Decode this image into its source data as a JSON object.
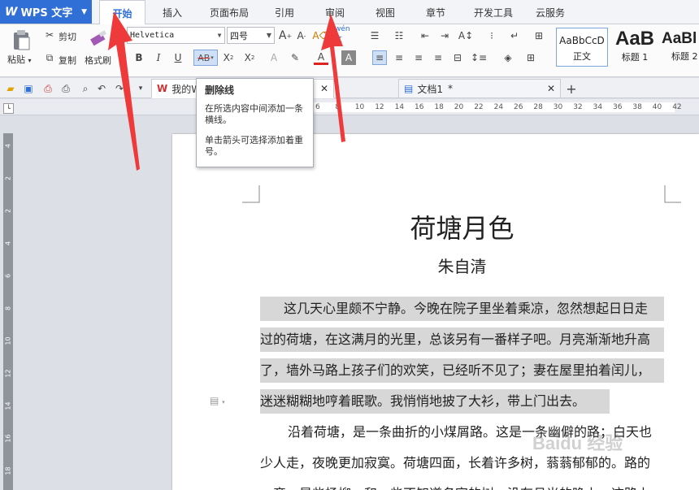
{
  "app": {
    "name": "WPS 文字",
    "logo_letter": "W",
    "accent": "#2f6fd6"
  },
  "menu": {
    "tabs": [
      "开始",
      "插入",
      "页面布局",
      "引用",
      "审阅",
      "视图",
      "章节",
      "开发工具",
      "云服务"
    ],
    "active": "开始"
  },
  "ribbon": {
    "paste": "粘贴",
    "cut": "剪切",
    "copy": "复制",
    "format_painter": "格式刷",
    "font_name": "Helvetica",
    "font_size": "四号",
    "styles": [
      {
        "preview": "AaBbCcD",
        "name": "正文"
      },
      {
        "preview": "AaB",
        "name": "标题 1"
      },
      {
        "preview": "AaBl",
        "name": "标题 2"
      }
    ]
  },
  "doc_tabs": [
    {
      "title": "我的W",
      "modified": "*"
    },
    {
      "title": "文档1",
      "modified": "*"
    }
  ],
  "tooltip": {
    "title": "删除线",
    "line1": "在所选内容中间添加一条横线。",
    "line2": "单击箭头可选择添加着重号。"
  },
  "ruler": {
    "top_ticks": [
      "6",
      "8",
      "10",
      "12",
      "14",
      "16",
      "18",
      "20",
      "22",
      "24",
      "26",
      "28",
      "30",
      "32",
      "34",
      "36",
      "38",
      "40",
      "42"
    ],
    "left_ticks": [
      "4",
      "2",
      "2",
      "4",
      "6",
      "8",
      "10",
      "12",
      "14",
      "16",
      "18"
    ]
  },
  "document": {
    "title": "荷塘月色",
    "author": "朱自清",
    "lines": [
      "这几天心里颇不宁静。今晚在院子里坐着乘凉，忽然想起日日走",
      "过的荷塘，在这满月的光里，总该另有一番样子吧。月亮渐渐地升高",
      "了，墙外马路上孩子们的欢笑，已经听不见了；妻在屋里拍着闰儿，",
      "迷迷糊糊地哼着眠歌。我悄悄地披了大衫，带上门出去。",
      "沿着荷塘，是一条曲折的小煤屑路。这是一条幽僻的路；白天也",
      "少人走，夜晚更加寂寞。荷塘四面，长着许多树，蓊蓊郁郁的。路的",
      "一旁，是些杨柳，和一些不知道名字的树。没有月光的晚上，这路上"
    ]
  },
  "watermark": "Baidu 经验"
}
